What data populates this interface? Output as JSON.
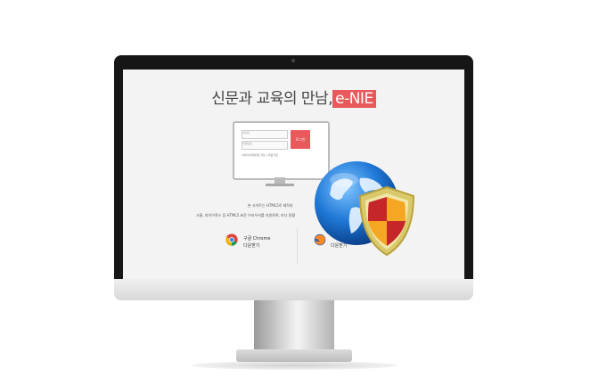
{
  "screen": {
    "headline": "신문과 교육의 만남,",
    "brand": "e-NIE",
    "login": {
      "id_placeholder": "아이디",
      "pw_placeholder": "비밀번호",
      "login_button": "로그인",
      "remember_label": "아이디/비밀번호 저장 | 회원가입"
    },
    "notice_line1": "본 사이트는 HTML5로 제작되",
    "notice_line2": "크롬, 파이어폭스 등 HTML5 표준 브라우저를 지원하며, 보다 원활",
    "downloads": {
      "chrome_name": "구글 Chrome",
      "chrome_download": "다운받기",
      "firefox_download": "다운받기"
    }
  },
  "colors": {
    "accent": "#e8595c",
    "bezel": "#161616",
    "screen_bg": "#f3f3f3"
  },
  "icons": [
    "chrome-icon",
    "firefox-icon",
    "globe-icon",
    "shield-icon"
  ]
}
